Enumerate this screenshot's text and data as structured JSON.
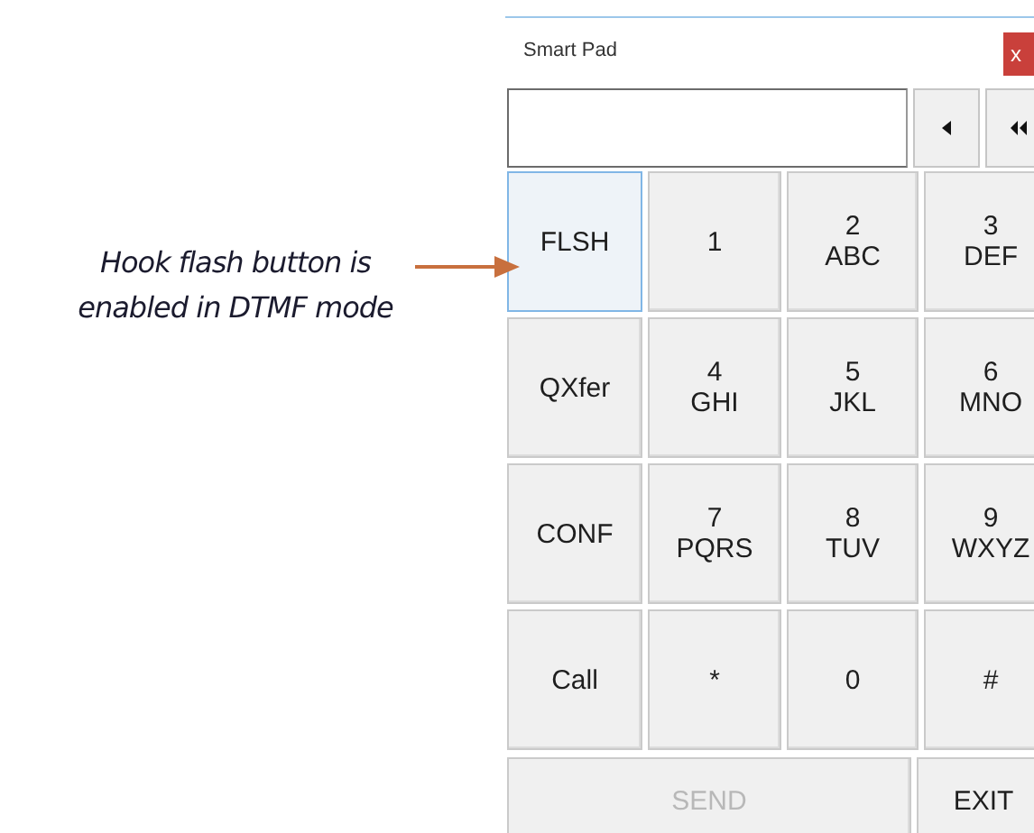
{
  "annotation": {
    "lines": [
      "Hook flash button is",
      "enabled in DTMF mode"
    ]
  },
  "window": {
    "title": "Smart Pad",
    "close": "x"
  },
  "nav_buttons": [
    {
      "kind": "single"
    },
    {
      "kind": "double"
    }
  ],
  "keys": [
    {
      "label": "FLSH",
      "focused": true
    },
    {
      "label": "1",
      "focused": false
    },
    {
      "label": "2",
      "letters": "ABC",
      "focused": false
    },
    {
      "label": "3",
      "letters": "DEF",
      "focused": false
    },
    {
      "label": "QXfer",
      "focused": false
    },
    {
      "label": "4",
      "letters": "GHI",
      "focused": false
    },
    {
      "label": "5",
      "letters": "JKL",
      "focused": false
    },
    {
      "label": "6",
      "letters": "MNO",
      "focused": false
    },
    {
      "label": "CONF",
      "focused": false
    },
    {
      "label": "7",
      "letters": "PQRS",
      "focused": false
    },
    {
      "label": "8",
      "letters": "TUV",
      "focused": false
    },
    {
      "label": "9",
      "letters": "WXYZ",
      "focused": false
    },
    {
      "label": "Call",
      "focused": false
    },
    {
      "label": "*",
      "focused": false
    },
    {
      "label": "0",
      "focused": false
    },
    {
      "label": "#",
      "focused": false
    }
  ],
  "bottom_buttons": [
    {
      "label": "SEND",
      "disabled": true
    },
    {
      "label": "EXIT",
      "disabled": false
    }
  ]
}
